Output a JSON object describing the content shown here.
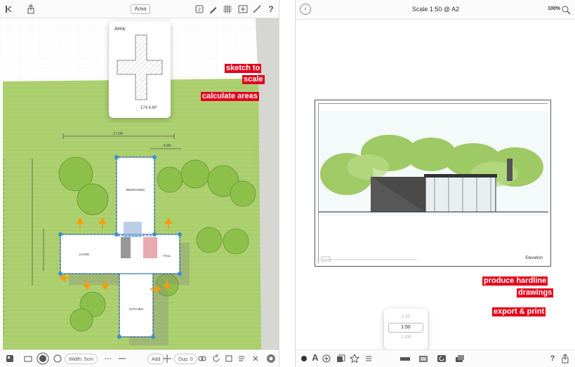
{
  "left_panel": {
    "toolbar": {
      "back_icon": "back-arrow-icon",
      "share_icon": "share-icon",
      "area_tab_label": "Area",
      "help_label": "?"
    },
    "area_popover": {
      "label": "Area:",
      "value": "174.6 M²"
    },
    "callouts": {
      "line1a": "sketch to",
      "line1b": "scale",
      "line2": "calculate areas"
    },
    "dimensions": {
      "top_width": "17.0M",
      "mid_width": "4.0M"
    },
    "room_labels": {
      "bedrooms": "BEDROOMS",
      "living": "LIVING",
      "kitchen": "KITCHEN",
      "hall": "HALL"
    },
    "bottombar": {
      "width_label": "Width: 5cm",
      "add_label": "Add",
      "dup_label": "Dup: 0"
    }
  },
  "right_panel": {
    "title": "Scale 1:50 @ A2",
    "zoom": "100%",
    "elevation_label": "Elevation",
    "callouts": {
      "line1a": "produce hardline",
      "line1b": "drawings",
      "line2": "export & print"
    },
    "scale_picker": {
      "above": "1:20",
      "selected": "1:50",
      "below": "1:100"
    },
    "bottombar": {
      "text_tool": "A",
      "help_label": "?"
    }
  },
  "colors": {
    "accent_red": "#e4001b",
    "grass": "#a9cf6a",
    "tree": "#8cc04a",
    "selection_blue": "#3b8fd4",
    "orange_arrow": "#f39c12"
  }
}
